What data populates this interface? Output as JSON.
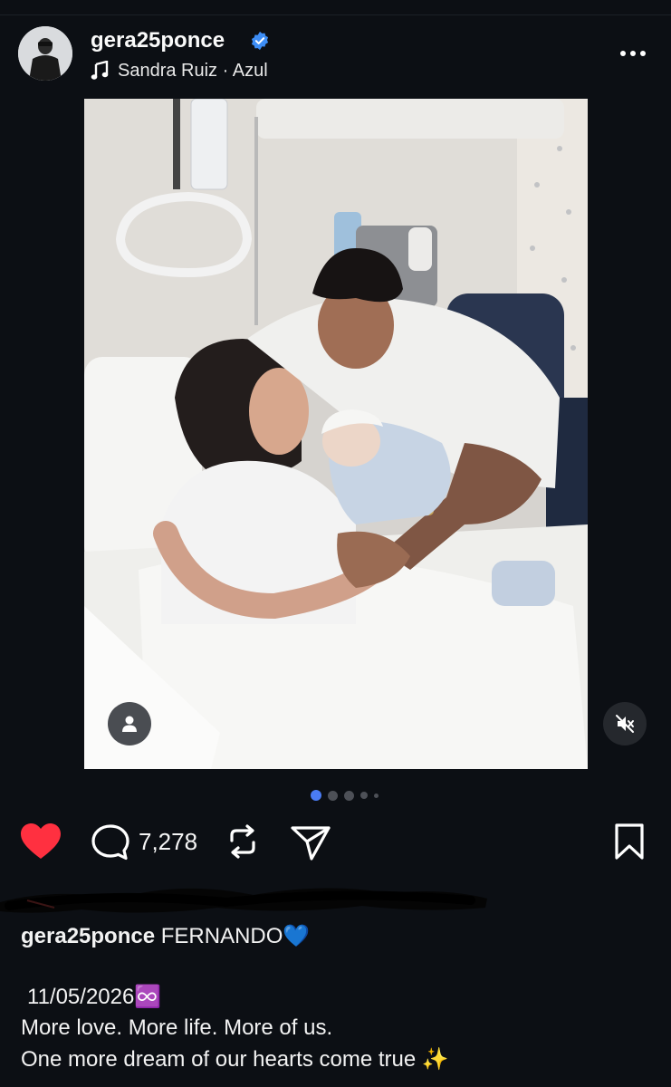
{
  "post": {
    "username": "gera25ponce",
    "verified": true,
    "music": {
      "artist": "Sandra Ruiz",
      "separator": " · ",
      "track": "Azul"
    },
    "carousel": {
      "count": 5,
      "active_index": 0
    },
    "photo_icon": "person-tag-icon",
    "mute_icon": "speaker-muted-icon"
  },
  "actions": {
    "liked": true,
    "comment_count": "7,278",
    "like_color": "#ff3040",
    "accent_dot": "#4a7cf5"
  },
  "caption": {
    "username": "gera25ponce",
    "text": " FERNANDO💙",
    "date": "11/05/2026♾️",
    "line2": "More love. More life. More of us.",
    "line3": "One more dream of our hearts come true ✨"
  }
}
